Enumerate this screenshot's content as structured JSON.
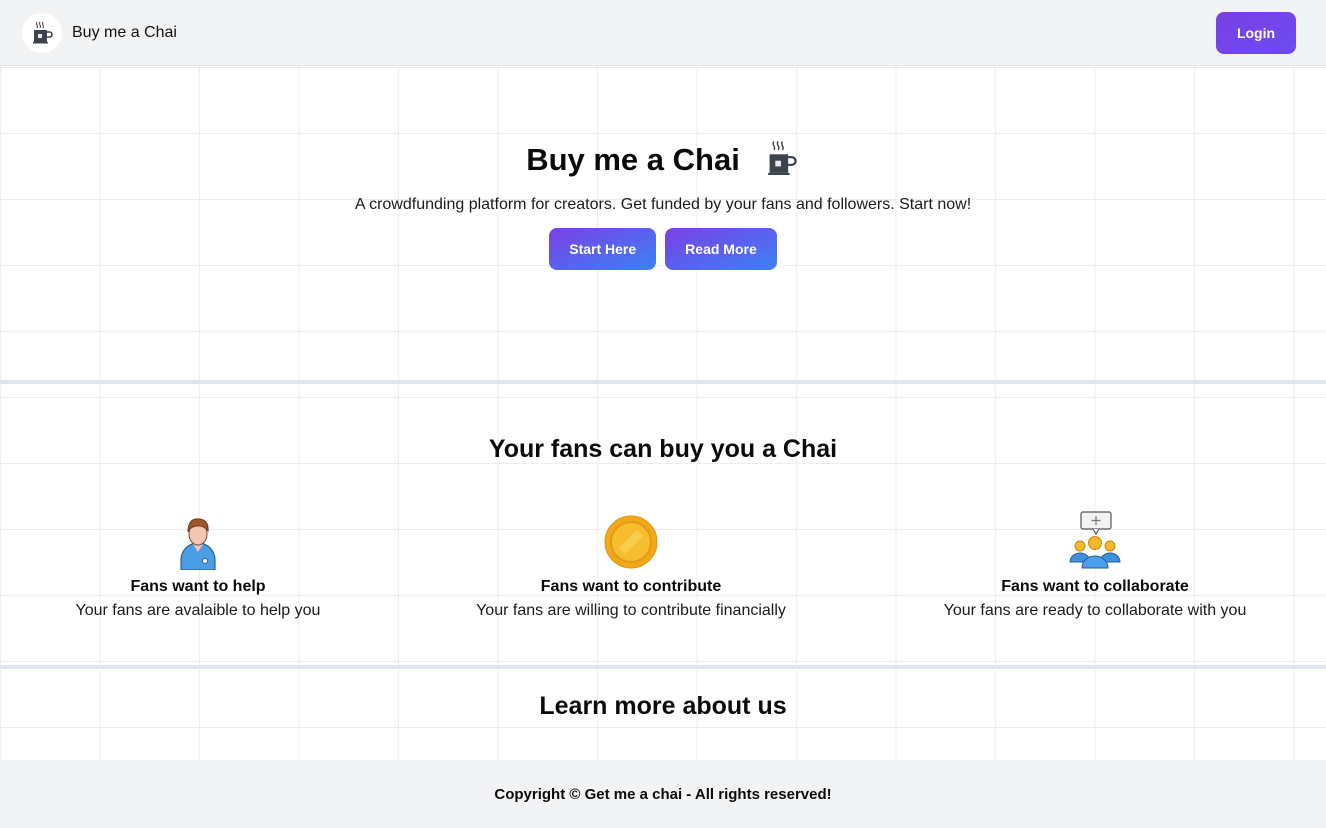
{
  "navbar": {
    "brand_name": "Buy me a Chai",
    "logo_icon": "chai-cup-icon",
    "login_label": "Login"
  },
  "hero": {
    "title": "Buy me a Chai",
    "title_icon": "chai-cup-icon",
    "subtitle": "A crowdfunding platform for creators. Get funded by your fans and followers. Start now!",
    "start_label": "Start Here",
    "read_more_label": "Read More"
  },
  "fans_section": {
    "title": "Your fans can buy you a Chai",
    "features": [
      {
        "icon": "person-icon",
        "title": "Fans want to help",
        "description": "Your fans are avalaible to help you"
      },
      {
        "icon": "coin-icon",
        "title": "Fans want to contribute",
        "description": "Your fans are willing to contribute financially"
      },
      {
        "icon": "group-chat-icon",
        "title": "Fans want to collaborate",
        "description": "Your fans are ready to collaborate with you"
      }
    ]
  },
  "learn_section": {
    "title": "Learn more about us"
  },
  "footer": {
    "copyright": "Copyright © Get me a chai - All rights reserved!"
  },
  "colors": {
    "button_gradient_start": "#7b3fe4",
    "button_gradient_end": "#3b82f6",
    "navbar_bg": "#f2f3f5",
    "divider": "#e2e6ee"
  }
}
